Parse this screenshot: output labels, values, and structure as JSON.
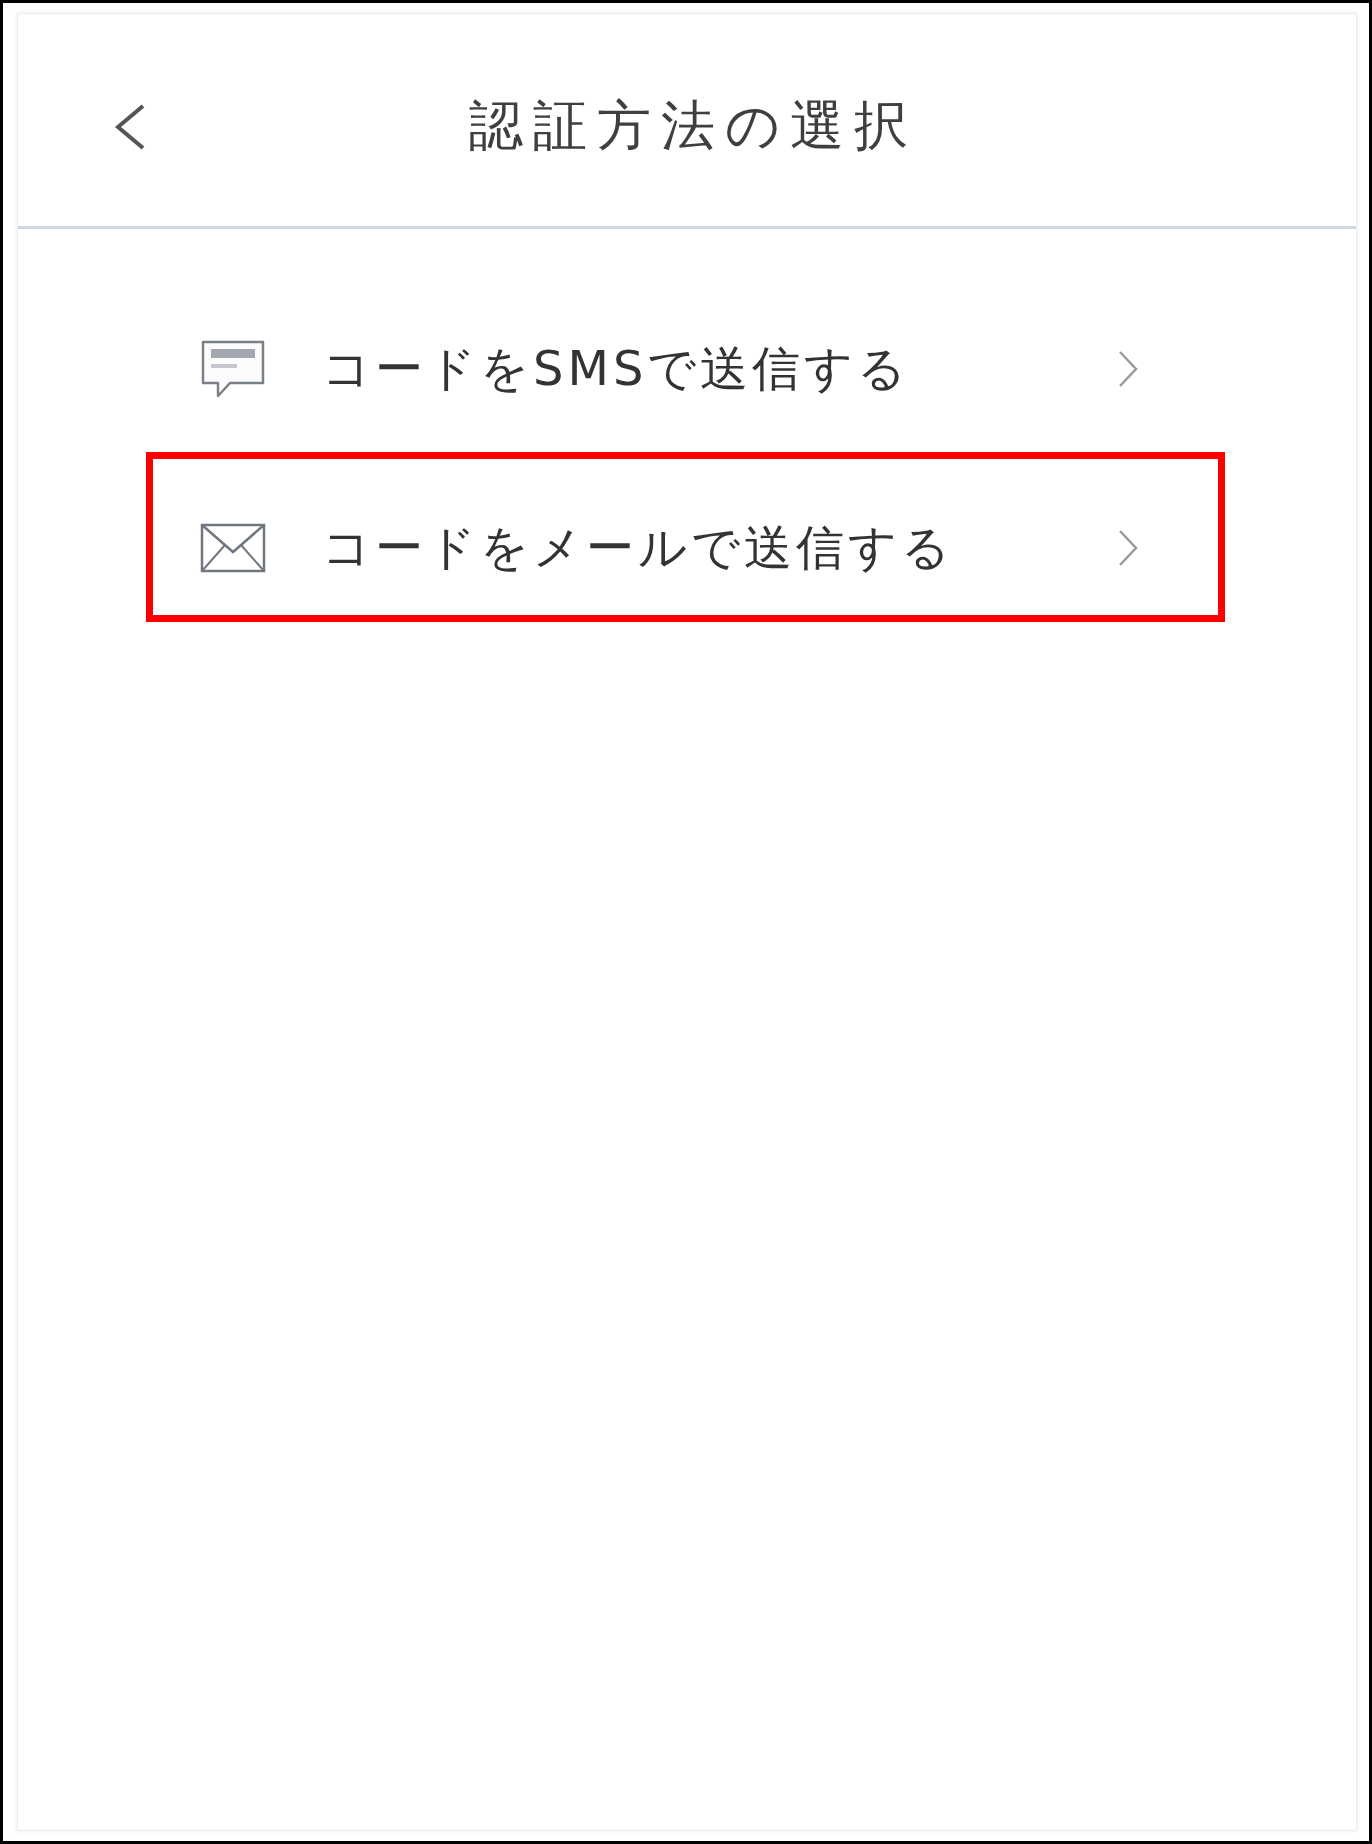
{
  "header": {
    "title": "認証方法の選択"
  },
  "options": [
    {
      "kind": "sms",
      "label": "コードをSMSで送信する",
      "highlighted": false
    },
    {
      "kind": "email",
      "label": "コードをメールで送信する",
      "highlighted": true
    }
  ]
}
